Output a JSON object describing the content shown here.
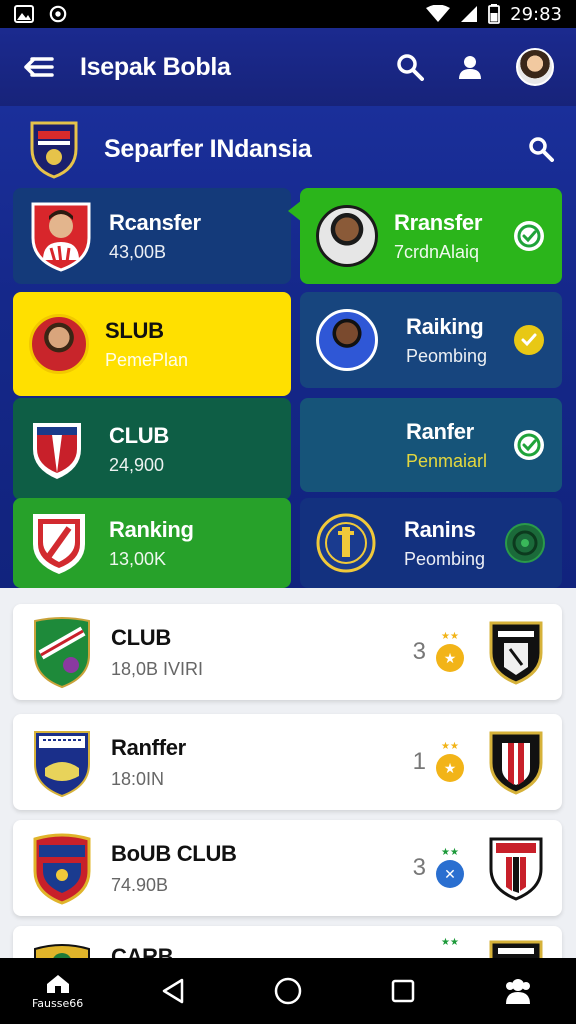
{
  "status": {
    "time": "29:83"
  },
  "app_bar": {
    "title": "Isepak Bobla"
  },
  "section": {
    "title": "Separfer INdansia"
  },
  "tiles": [
    {
      "title": "Rcansfer",
      "subtitle": "43,00B",
      "bg": "#143a7a"
    },
    {
      "title": "Rransfer",
      "subtitle": "7crdnAlaiq",
      "bg": "#2bb51b"
    },
    {
      "title": "SLUB",
      "subtitle": "PemePlan",
      "bg": "#ffe000"
    },
    {
      "title": "Raiking",
      "subtitle": "Peombing",
      "bg": "#17457e"
    },
    {
      "title": "CLUB",
      "subtitle": "24,900",
      "bg": "#0e5e45"
    },
    {
      "title": "Ranfer",
      "subtitle": "Penmaiarl",
      "bg": "#165479"
    },
    {
      "title": "Ranking",
      "subtitle": "13,00K",
      "bg": "#27a12a"
    },
    {
      "title": "Ranins",
      "subtitle": "Peombing",
      "bg": "#13317f"
    }
  ],
  "list": [
    {
      "title": "CLUB",
      "subtitle": "18,0B IVIRI",
      "rank": "3",
      "medal_color": "#f2b418",
      "star_color": "#f2b418",
      "medal_glyph": "★"
    },
    {
      "title": "Ranffer",
      "subtitle": "18:0IN",
      "rank": "1",
      "medal_color": "#f2b418",
      "star_color": "#f2b418",
      "medal_glyph": "★"
    },
    {
      "title": "BoUB CLUB",
      "subtitle": "74.90B",
      "rank": "3",
      "medal_color": "#2a6fd0",
      "star_color": "#1d9a3a",
      "medal_glyph": "✕"
    },
    {
      "title": "CARB",
      "subtitle": "",
      "rank": "",
      "medal_color": "#f2b418",
      "star_color": "#1d9a3a",
      "medal_glyph": ""
    }
  ],
  "bottom_nav": {
    "home_label": "Fausse66"
  },
  "colors": {
    "app_bar": "#1b2a8f",
    "hero": "#15288a",
    "check_green": "#2bb51b",
    "check_yellow": "#e8c815"
  }
}
